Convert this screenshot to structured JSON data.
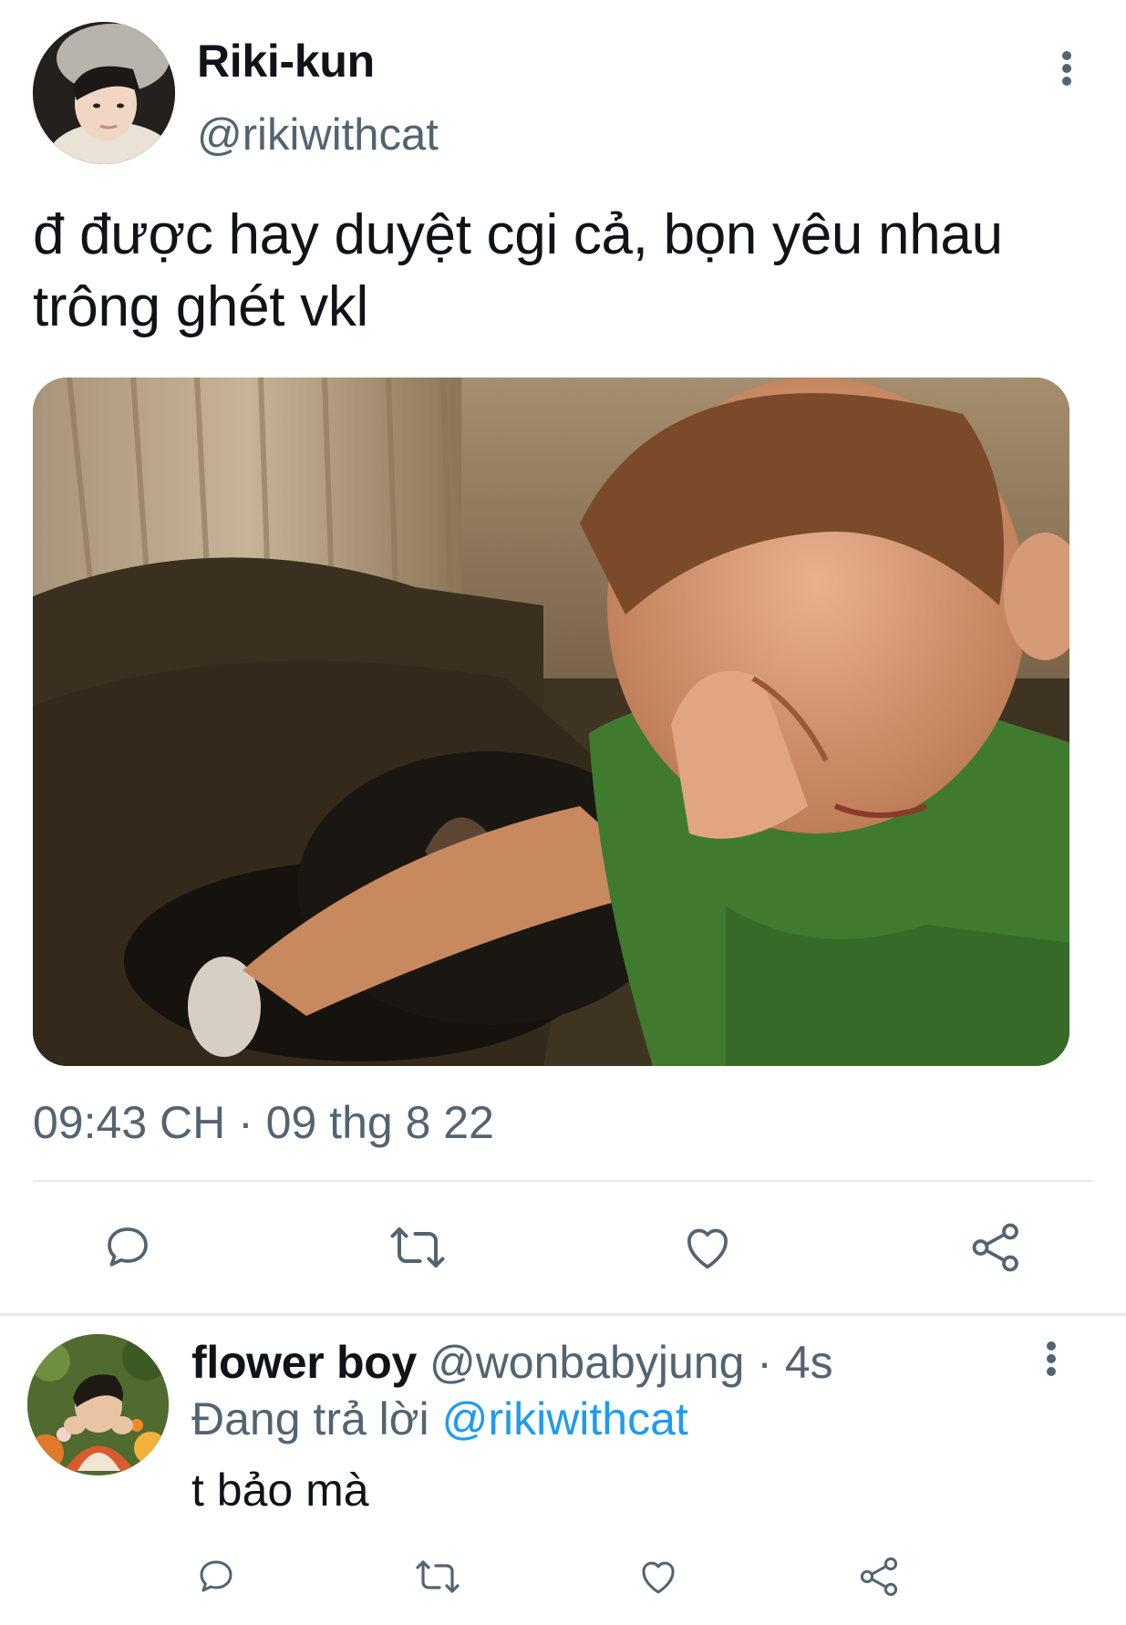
{
  "tweet": {
    "author": {
      "display_name": "Riki-kun",
      "handle": "@rikiwithcat"
    },
    "text": "đ được hay duyệt cgi cả, bọn yêu nhau trông ghét vkl",
    "timestamp": "09:43 CH · 09 thg 8 22",
    "actions": [
      "reply-icon",
      "retweet-icon",
      "like-icon",
      "share-icon"
    ]
  },
  "reply": {
    "author": {
      "display_name": "flower boy",
      "handle": "@wonbabyjung"
    },
    "time_ago": "· 4s",
    "replying_prefix": "Đang trả lời",
    "replying_to": "@rikiwithcat",
    "text": "t bảo mà",
    "actions": [
      "reply-icon",
      "retweet-icon",
      "like-icon",
      "share-icon"
    ]
  },
  "colors": {
    "text_primary": "#0f1419",
    "text_secondary": "#536471",
    "link": "#1d9bf0",
    "divider": "#e6e9ec",
    "icon": "#536471"
  }
}
